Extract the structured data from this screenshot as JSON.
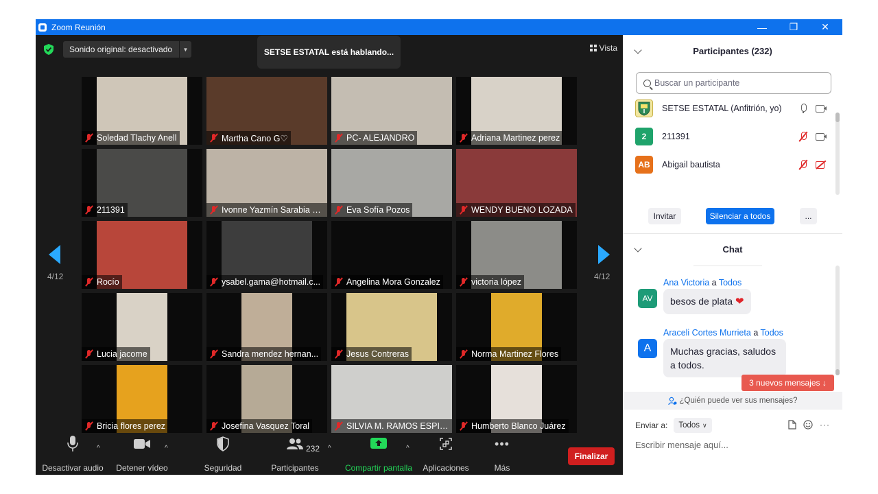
{
  "window": {
    "title": "Zoom Reunión",
    "controls": {
      "minimize": "—",
      "restore": "❐",
      "close": "✕"
    }
  },
  "top": {
    "sound_label": "Sonido original: desactivado",
    "speaking": "SETSE ESTATAL está hablando...",
    "view_label": "Vista"
  },
  "pager": {
    "left": "4/12",
    "right": "4/12"
  },
  "tiles": [
    {
      "name": "Soledad Tlachy Anell",
      "bg": "#cfc6b8"
    },
    {
      "name": "Martha Cano G♡",
      "bg": "#5a3b2a"
    },
    {
      "name": "PC- ALEJANDRO",
      "bg": "#c4bdb2"
    },
    {
      "name": "Adriana Martinez perez",
      "bg": "#d8d2c8"
    },
    {
      "name": "211391",
      "bg": "#4a4a48"
    },
    {
      "name": "Ivonne Yazmín Sarabia R...",
      "bg": "#bdb3a6"
    },
    {
      "name": "Eva Sofía Pozos",
      "bg": "#a8a8a4"
    },
    {
      "name": "WENDY BUENO LOZADA",
      "bg": "#8a3a3a"
    },
    {
      "name": "Rocío",
      "bg": "#b8463a"
    },
    {
      "name": "ysabel.gama@hotmail.c...",
      "bg": "#3d3d3d"
    },
    {
      "name": "Angelina Mora Gonzalez",
      "bg": "#0b0b0b"
    },
    {
      "name": "victoria lópez",
      "bg": "#8c8c88"
    },
    {
      "name": "Lucia jacome",
      "bg": "#d9d2c6"
    },
    {
      "name": "Sandra mendez hernan...",
      "bg": "#bfae98"
    },
    {
      "name": "Jesus Contreras",
      "bg": "#d8c58a"
    },
    {
      "name": "Norma Martinez Flores",
      "bg": "#e0ab2b"
    },
    {
      "name": "Bricia flores perez",
      "bg": "#e6a21e"
    },
    {
      "name": "Josefina Vasquez Toral",
      "bg": "#b6aa96"
    },
    {
      "name": "SILVIA M. RAMOS ESPIN...",
      "bg": "#cfcfcc"
    },
    {
      "name": "Humberto Blanco Juárez",
      "bg": "#e6e0da"
    }
  ],
  "toolbar": {
    "audio": "Desactivar audio",
    "video": "Detener vídeo",
    "security": "Seguridad",
    "participants": "Participantes",
    "participants_count": "232",
    "share": "Compartir pantalla",
    "apps": "Aplicaciones",
    "more": "Más",
    "end": "Finalizar"
  },
  "participants_panel": {
    "title": "Participantes (232)",
    "search_placeholder": "Buscar un participante",
    "list": [
      {
        "name": "SETSE ESTATAL (Anfitrión, yo)",
        "avatar": "",
        "color": "#f2e7a0",
        "mic": "on",
        "cam": "on"
      },
      {
        "name": "211391",
        "avatar": "2",
        "color": "#1fa36b",
        "mic": "off",
        "cam": "on"
      },
      {
        "name": "Abigail bautista",
        "avatar": "AB",
        "color": "#e6711b",
        "mic": "off",
        "cam": "off"
      }
    ],
    "invite": "Invitar",
    "mute_all": "Silenciar a todos",
    "more": "..."
  },
  "chat": {
    "title": "Chat",
    "messages": [
      {
        "sender": "Ana Victoria",
        "to_word": "a",
        "to": "Todos",
        "avatar": "AV",
        "color": "#1d9b77",
        "text": "besos de plata",
        "emoji": "❤"
      },
      {
        "sender": "Araceli Cortes Murrieta",
        "to_word": "a",
        "to": "Todos",
        "avatar": "A",
        "color": "#0e72ed",
        "text_line1": "Muchas gracias, saludos",
        "text_line2": "a todos."
      }
    ],
    "new_messages": "3 nuevos mensajes ↓",
    "who_can_see": "¿Quién puede ver sus mensajes?",
    "send_to_label": "Enviar a:",
    "send_to_value": "Todos",
    "input_placeholder": "Escribir mensaje aquí..."
  }
}
